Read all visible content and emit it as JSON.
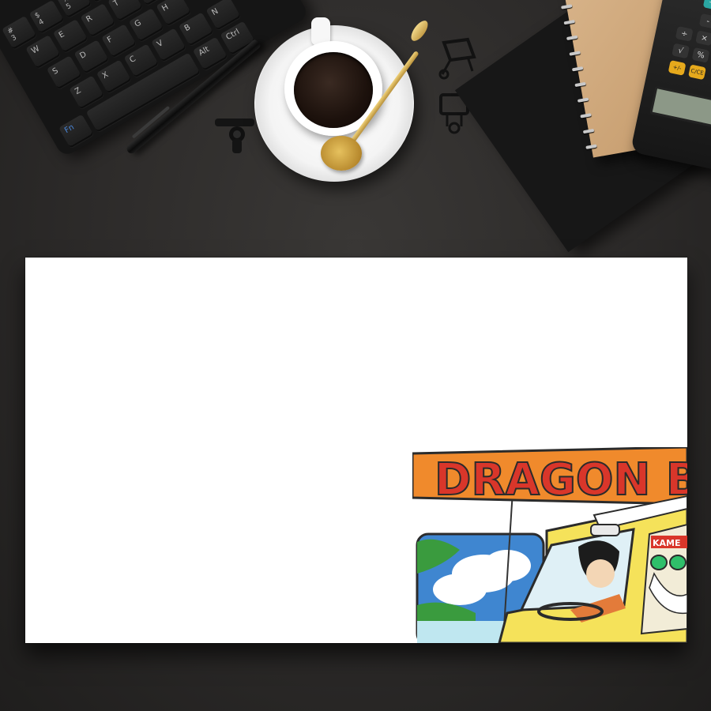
{
  "keyboard": {
    "rows": [
      [
        "#\n3",
        "$\n4",
        "%\n5",
        "^\n6",
        "&\n7"
      ],
      [
        "W",
        "E",
        "R",
        "T",
        "Y",
        "U"
      ],
      [
        "S",
        "D",
        "F",
        "G",
        "H"
      ],
      [
        "Z",
        "X",
        "C",
        "V",
        "B",
        "N"
      ]
    ],
    "mod_keys": [
      "Alt",
      "Ctrl",
      "Fn"
    ]
  },
  "calculator": {
    "keys": [
      "+",
      "-",
      "×",
      "%",
      "÷",
      "√",
      "+/-",
      "C/CE"
    ]
  },
  "artwork": {
    "logo_text": "DRAGON BALL",
    "headband_text": "KAME"
  },
  "colors": {
    "desk": "#2e2c2b",
    "card": "#ffffff",
    "logo_orange": "#f08a2c",
    "logo_red": "#d9362a",
    "car_yellow": "#f5e25a",
    "sky_blue": "#3f86d0",
    "cup_gold": "#c79a3e"
  }
}
